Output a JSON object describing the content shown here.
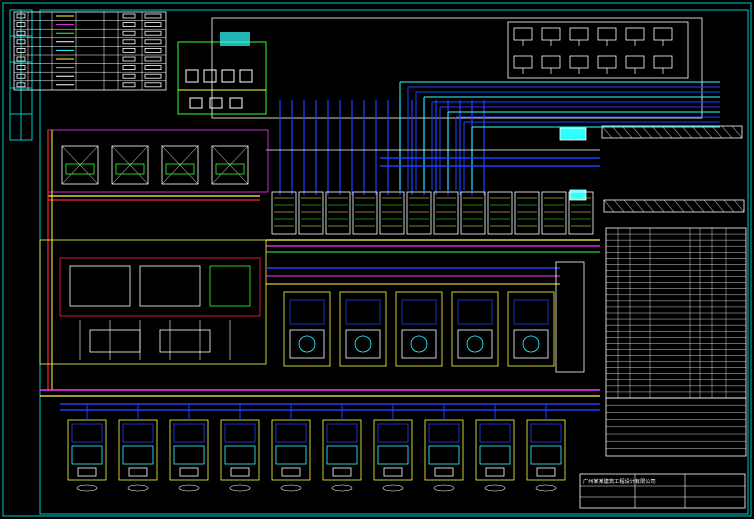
{
  "drawing": {
    "background": "#000000",
    "frame_color": "#00c8c8",
    "colors": {
      "blue": "#2040ff",
      "red": "#ff2040",
      "yellow": "#ffff40",
      "green": "#30ff30",
      "magenta": "#ff30ff",
      "cyan": "#30ffff",
      "white": "#ffffff"
    }
  },
  "legend": {
    "rows": 9
  },
  "title_block": {
    "company": "广州某某建筑工程设计有限公司"
  },
  "equipment_table": {
    "rows": 28
  }
}
